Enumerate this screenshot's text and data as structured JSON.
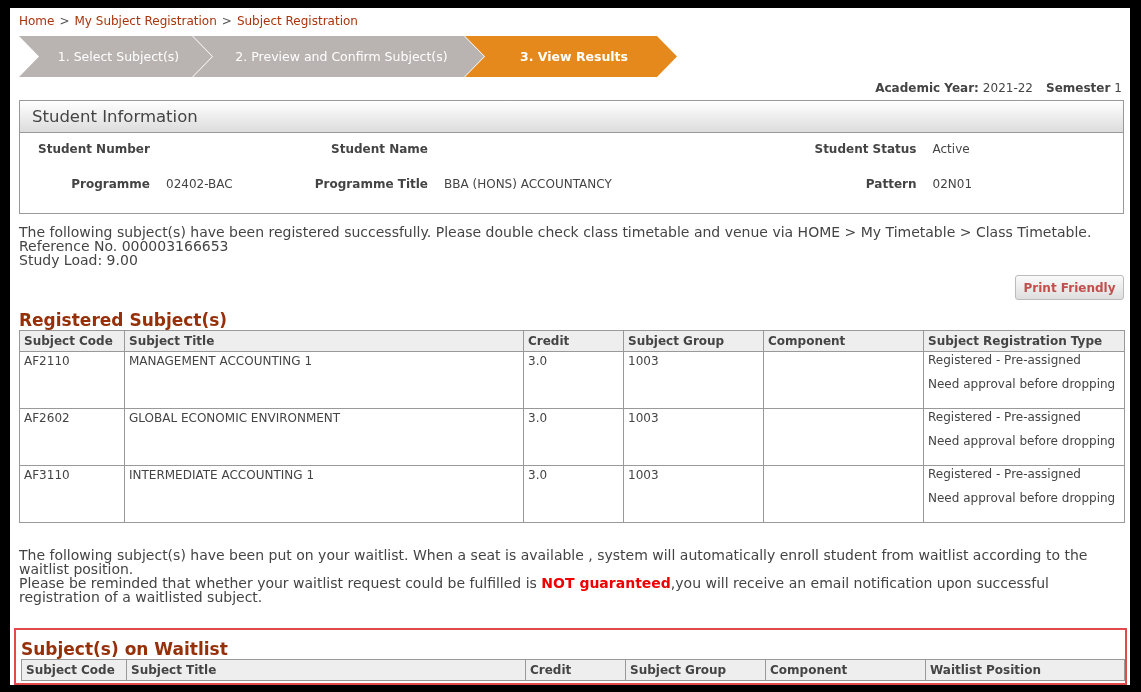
{
  "breadcrumb": [
    {
      "kind": "link",
      "text": "Home"
    },
    {
      "kind": "separator",
      "text": ">"
    },
    {
      "kind": "link",
      "text": "My Subject Registration"
    },
    {
      "kind": "separator",
      "text": ">"
    },
    {
      "kind": "link",
      "text": "Subject Registration"
    }
  ],
  "steps": [
    {
      "label": "1. Select Subject(s)",
      "selected": false
    },
    {
      "label": "2. Preview and Confirm Subject(s)",
      "selected": false
    },
    {
      "label": "3. View Results",
      "selected": true
    }
  ],
  "term": {
    "year_label": "Academic Year:",
    "year": "2021-22",
    "semester_label": "Semester",
    "semester": "1"
  },
  "student_info": {
    "title": "Student Information",
    "rows": [
      [
        {
          "label": "Student Number"
        },
        {
          "label": "Student Name"
        },
        {
          "label": "Student Status",
          "value": "Active"
        }
      ],
      [
        {
          "label": "Programme",
          "value": "02402-BAC"
        },
        {
          "label": "Programme Title",
          "value": "BBA (HONS) ACCOUNTANCY"
        },
        {
          "label": "Pattern",
          "value": "02N01"
        }
      ]
    ]
  },
  "success_message": [
    "The following subject(s) have been registered successfully. Please double check class timetable and venue via HOME > My Timetable > Class Timetable.",
    "Reference No. 000003166653",
    "Study Load: 9.00"
  ],
  "print_button": "Print Friendly",
  "registered": {
    "title": "Registered Subject(s)",
    "columns": [
      "Subject Code",
      "Subject Title",
      "Credit",
      "Subject Group",
      "Component",
      "Subject Registration Type"
    ],
    "rows": [
      {
        "code": "AF2110",
        "title": "MANAGEMENT ACCOUNTING 1",
        "credit": "3.0",
        "group": "1003",
        "registration_type": [
          "Registered - Pre-assigned",
          "Need approval before dropping"
        ]
      },
      {
        "code": "AF2602",
        "title": "GLOBAL ECONOMIC ENVIRONMENT",
        "credit": "3.0",
        "group": "1003",
        "registration_type": [
          "Registered - Pre-assigned",
          "Need approval before dropping"
        ]
      },
      {
        "code": "AF3110",
        "title": "INTERMEDIATE ACCOUNTING 1",
        "credit": "3.0",
        "group": "1003",
        "registration_type": [
          "Registered - Pre-assigned",
          "Need approval before dropping"
        ]
      }
    ]
  },
  "waitlist_message": [
    "The following subject(s) have been put on your waitlist. When a seat is available , system will automatically enroll student from waitlist according to the waitlist position.",
    "Please be reminded that whether your waitlist request could be fulfilled is **NOT guaranteed**,you will receive an email notification upon successful registration of a waitlisted subject."
  ],
  "waitlist": {
    "title": "Subject(s) on Waitlist",
    "highlighted": true,
    "columns": [
      "Subject Code",
      "Subject Title",
      "Credit",
      "Subject Group",
      "Component",
      "Waitlist Position"
    ]
  }
}
